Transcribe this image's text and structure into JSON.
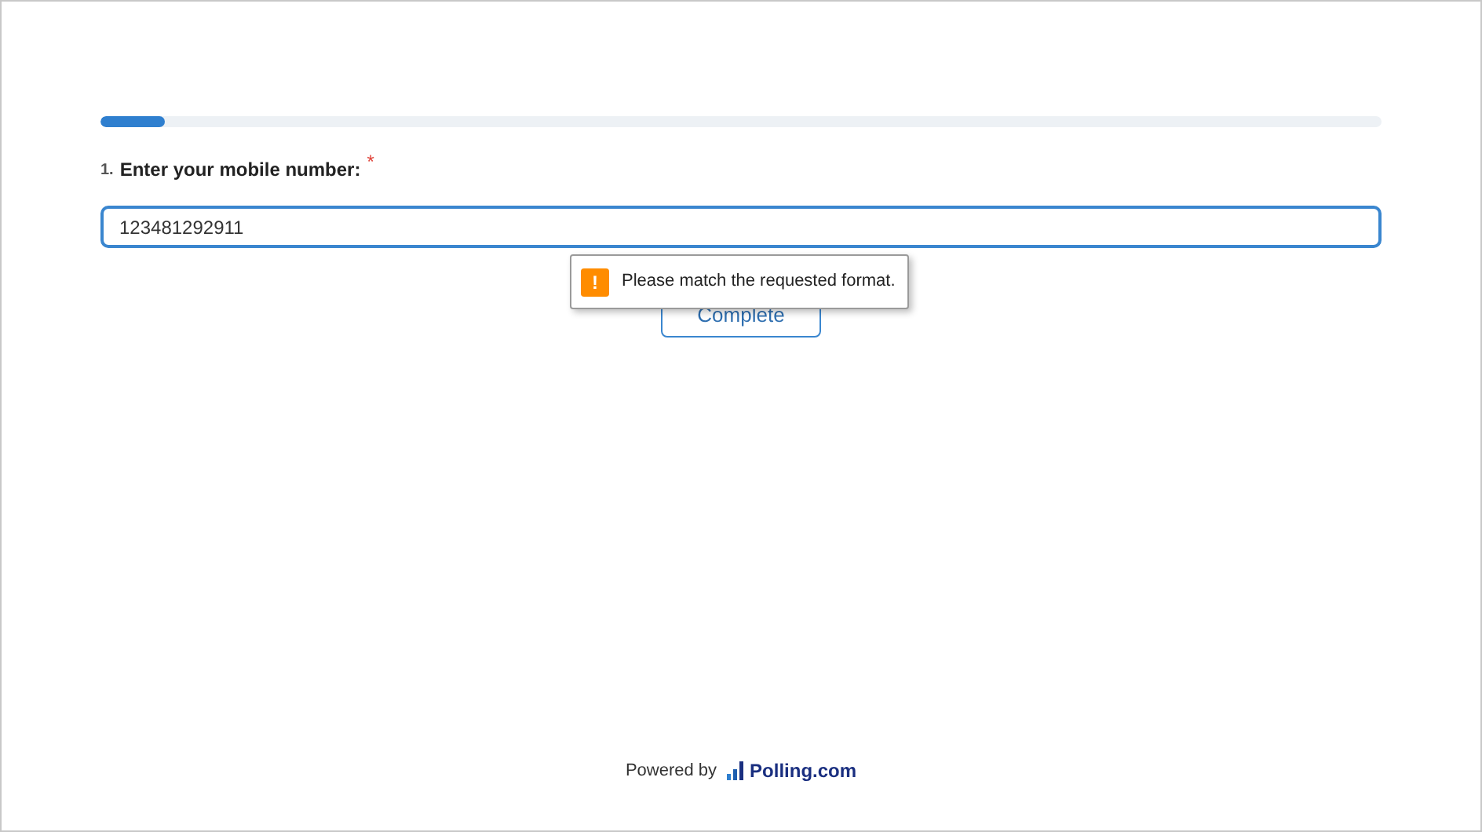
{
  "progress": {
    "level": 0.05
  },
  "question": {
    "number": "1.",
    "label": "Enter your mobile number:",
    "required_mark": "*",
    "value": "123481292911"
  },
  "tooltip": {
    "icon": "!",
    "message": "Please match the requested format."
  },
  "complete_button": {
    "label": "Complete"
  },
  "footer": {
    "powered_by": "Powered by",
    "brand": "Polling.com"
  }
}
